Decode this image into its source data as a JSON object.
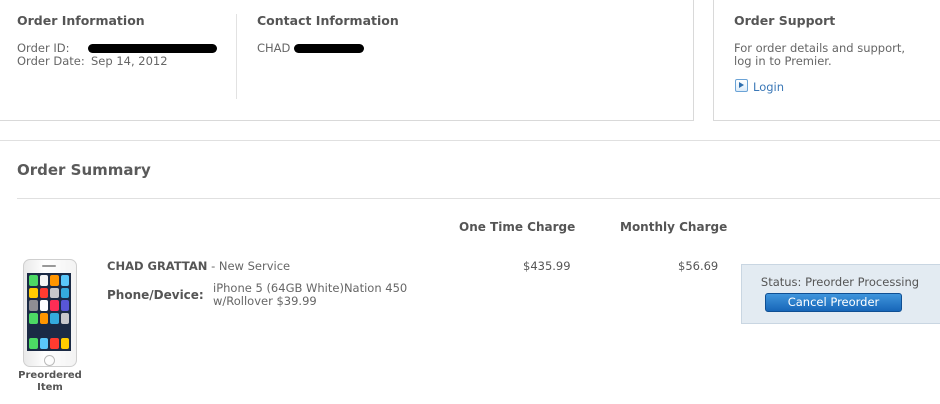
{
  "order_info": {
    "title": "Order Information",
    "order_id_label": "Order ID:",
    "order_date_label": "Order Date:",
    "order_date": "Sep 14, 2012"
  },
  "contact_info": {
    "title": "Contact Information",
    "name_visible": "CHAD"
  },
  "order_support": {
    "title": "Order Support",
    "description_line1": "For order details and support,",
    "description_line2": "log in to Premier.",
    "login_label": "Login"
  },
  "summary": {
    "title": "Order Summary",
    "columns": {
      "one_time": "One Time Charge",
      "monthly": "Monthly Charge"
    },
    "item": {
      "customer": "CHAD GRATTAN",
      "service": "- New Service",
      "device_label": "Phone/Device:",
      "device_line1": "iPhone 5 (64GB White)Nation 450",
      "device_line2": "w/Rollover $39.99",
      "one_time_charge": "$435.99",
      "monthly_charge": "$56.69",
      "image_caption_line1": "Preordered",
      "image_caption_line2": "Item",
      "status": "Status: Preorder Processing",
      "cancel_label": "Cancel Preorder"
    }
  },
  "icons": {
    "login": "play-arrow-icon",
    "phone": "iphone-image"
  },
  "colors": {
    "link": "#3b78b7",
    "button": "#1f73c4",
    "status_bg": "#e3ebf2",
    "redaction": "#000000"
  }
}
